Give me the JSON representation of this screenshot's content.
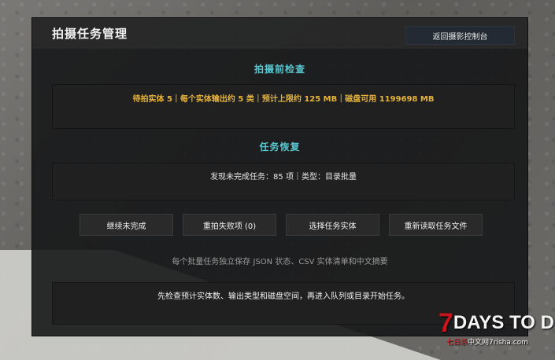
{
  "window": {
    "title": "拍摄任务管理",
    "back_button": "返回摄影控制台"
  },
  "precheck": {
    "heading": "拍摄前检查",
    "summary": "待拍实体 5｜每个实体输出约 5 类｜预计上限约 125 MB｜磁盘可用 1199698 MB"
  },
  "recovery": {
    "heading": "任务恢复",
    "status": "发现未完成任务：85 项｜类型：目录批量"
  },
  "actions": {
    "continue": "继续未完成",
    "retry_failed": "重拍失败项 (0)",
    "select_entities": "选择任务实体",
    "reload_file": "重新读取任务文件"
  },
  "note": "每个批量任务独立保存 JSON 状态、CSV 实体清单和中文摘要",
  "footer": {
    "hint": "先检查预计实体数、输出类型和磁盘空间，再进入队列或目录开始任务。"
  },
  "watermark": {
    "brand_seven": "7",
    "brand_rest": "DAYS TO DIE",
    "sub_red": "七日杀",
    "sub_rest": "中文网7risha.com"
  },
  "colors": {
    "accent": "#58c7cf",
    "warning": "#e6b33a",
    "panel": "#161718"
  }
}
